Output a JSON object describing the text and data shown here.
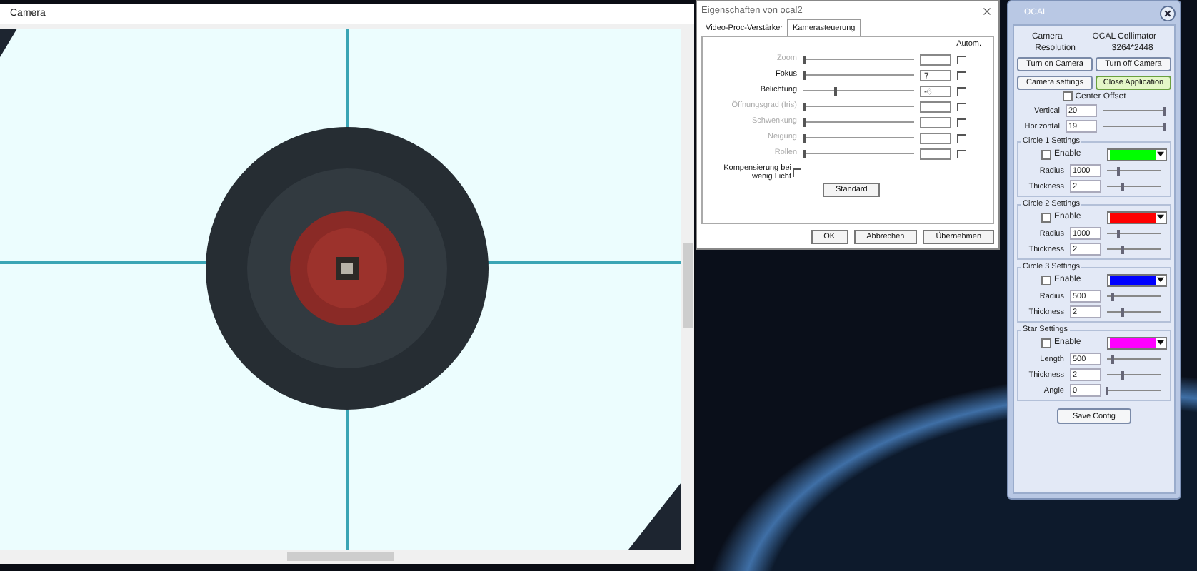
{
  "camera_window": {
    "title": "Camera"
  },
  "properties_dialog": {
    "title": "Eigenschaften von ocal2",
    "tabs": [
      {
        "label": "Video-Proc-Verstärker",
        "selected": false
      },
      {
        "label": "Kamerasteuerung",
        "selected": true
      }
    ],
    "auto_header": "Autom.",
    "controls": [
      {
        "label": "Zoom",
        "level": 0,
        "auto": false,
        "disabled": true
      },
      {
        "label": "Fokus",
        "level": 0,
        "value": "7",
        "auto": false,
        "disabled": false
      },
      {
        "label": "Belichtung",
        "level": 0.28,
        "value": "-6",
        "auto": false,
        "disabled": false
      },
      {
        "label": "Öffnungsgrad (Iris)",
        "level": 0,
        "auto": false,
        "disabled": true
      },
      {
        "label": "Schwenkung",
        "level": 0,
        "auto": false,
        "disabled": true
      },
      {
        "label": "Neigung",
        "level": 0,
        "auto": false,
        "disabled": true
      },
      {
        "label": "Rollen",
        "level": 0,
        "auto": false,
        "disabled": true
      }
    ],
    "low_light": {
      "label": "Kompensierung bei wenig Licht",
      "checked": false
    },
    "standard_button": "Standard",
    "buttons": [
      "OK",
      "Abbrechen",
      "Übernehmen"
    ]
  },
  "ocal_panel": {
    "title": "OCAL",
    "info": [
      {
        "label": "Camera",
        "value": "OCAL Collimator"
      },
      {
        "label": "Resolution",
        "value": "3264*2448"
      }
    ],
    "buttons": [
      {
        "label": "Turn on Camera",
        "highlighted": false
      },
      {
        "label": "Turn off Camera",
        "highlighted": false
      },
      {
        "label": "Camera settings",
        "highlighted": false
      },
      {
        "label": "Close Application",
        "highlighted": true
      }
    ],
    "center_offset": {
      "label": "Center Offset",
      "checked": false
    },
    "offsets": [
      {
        "label": "Vertical",
        "value": "20",
        "level": 0.97
      },
      {
        "label": "Horizontal",
        "value": "19",
        "level": 0.97
      }
    ],
    "sections": [
      {
        "title": "Circle 1 Settings",
        "enable": {
          "label": "Enable",
          "checked": false
        },
        "color": "#00ff00",
        "fields": [
          {
            "label": "Radius",
            "value": "1000",
            "level": 0.2
          },
          {
            "label": "Thickness",
            "value": "2",
            "level": 0.3
          }
        ]
      },
      {
        "title": "Circle 2 Settings",
        "enable": {
          "label": "Enable",
          "checked": false
        },
        "color": "#ff0000",
        "fields": [
          {
            "label": "Radius",
            "value": "1000",
            "level": 0.2
          },
          {
            "label": "Thickness",
            "value": "2",
            "level": 0.3
          }
        ]
      },
      {
        "title": "Circle 3 Settings",
        "enable": {
          "label": "Enable",
          "checked": false
        },
        "color": "#0000ff",
        "fields": [
          {
            "label": "Radius",
            "value": "500",
            "level": 0.1
          },
          {
            "label": "Thickness",
            "value": "2",
            "level": 0.3
          }
        ]
      },
      {
        "title": "Star Settings",
        "enable": {
          "label": "Enable",
          "checked": false
        },
        "color": "#ff00ff",
        "fields": [
          {
            "label": "Length",
            "value": "500",
            "level": 0.1
          },
          {
            "label": "Thickness",
            "value": "2",
            "level": 0.3
          },
          {
            "label": "Angle",
            "value": "0",
            "level": 0
          }
        ]
      }
    ],
    "save_button": "Save Config"
  }
}
